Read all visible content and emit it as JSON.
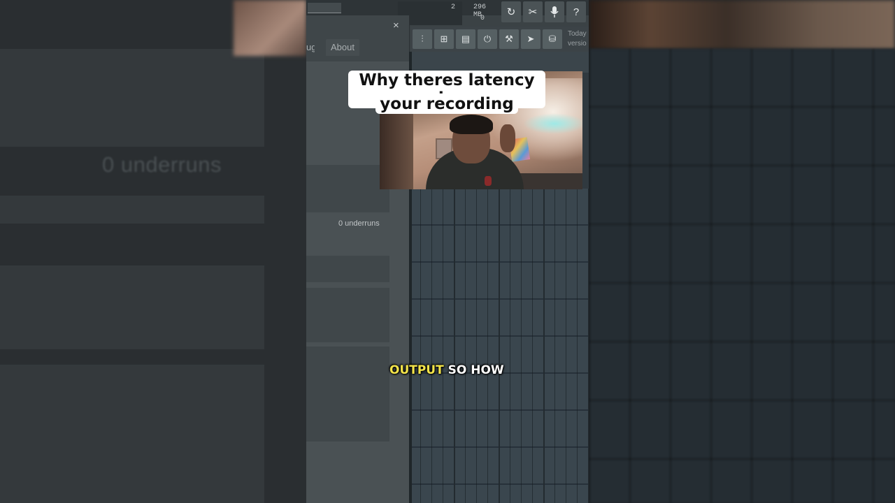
{
  "background_blur": {
    "ghost_text": "0 underruns"
  },
  "daw": {
    "top": {
      "memory": "296 MB",
      "cpu_value": "2",
      "poly_value": "0"
    },
    "toolbar": {
      "icons": [
        "undo-icon",
        "cut-icon",
        "mic-icon",
        "help-icon"
      ],
      "help_label": "?"
    },
    "dialog": {
      "close_label": "×",
      "tabs": [
        {
          "label": "ug"
        },
        {
          "label": "About"
        }
      ],
      "underruns": "0 underruns"
    },
    "tool_row": {
      "icons": [
        "mixer-icon",
        "browser-icon",
        "file-icon",
        "plugin-icon",
        "piano-icon",
        "tutorial-icon",
        "shop-icon"
      ],
      "today_line1": "Today",
      "today_line2": "versio"
    }
  },
  "overlay": {
    "title_line1": "Why theres latency in",
    "title_line2": "your recording",
    "subtitle_highlight": "OUTPUT",
    "subtitle_rest": "SO HOW"
  },
  "colors": {
    "subtitle_highlight": "#f3e44a",
    "caption_bg": "#ffffff"
  }
}
